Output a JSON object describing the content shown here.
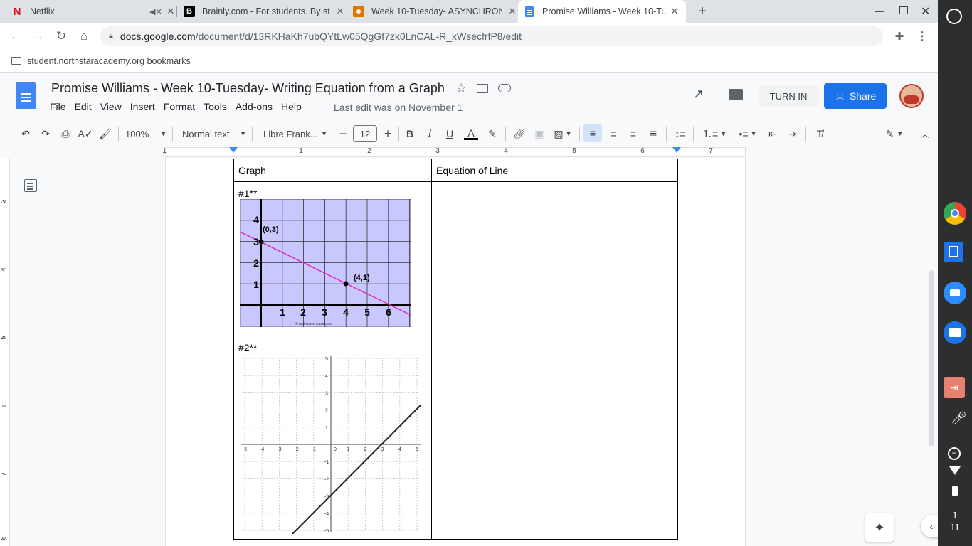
{
  "tabs": [
    {
      "title": "Netflix",
      "favicon": "N"
    },
    {
      "title": "Brainly.com - For students. By st",
      "favicon": "B"
    },
    {
      "title": "Week 10-Tuesday- ASYNCHRON",
      "favicon": "classroom-icon"
    },
    {
      "title": "Promise Williams - Week 10-Tue",
      "favicon": "docs-icon",
      "active": true
    }
  ],
  "url": {
    "domain": "docs.google.com",
    "path": "/document/d/13RKHaKh7ubQYtLw05QgGf7zk0LnCAL-R_xWsecfrfP8/edit"
  },
  "bookmarks": {
    "label": "student.northstaracademy.org bookmarks"
  },
  "doc": {
    "title": "Promise Williams - Week 10-Tuesday- Writing Equation from a Graph",
    "menus": [
      "File",
      "Edit",
      "View",
      "Insert",
      "Format",
      "Tools",
      "Add-ons",
      "Help"
    ],
    "last_edit": "Last edit was on November 1",
    "turn_in": "TURN IN",
    "share": "Share"
  },
  "format": {
    "zoom": "100%",
    "style": "Normal text",
    "font": "Libre Frank...",
    "size": "12"
  },
  "ruler": {
    "h": [
      "1",
      "1",
      "2",
      "3",
      "4",
      "5",
      "6",
      "7"
    ],
    "v": [
      "3",
      "4",
      "5",
      "6",
      "7",
      "8"
    ]
  },
  "table": {
    "headers": [
      "Graph",
      "Equation of Line"
    ],
    "rows": [
      {
        "label": "#1**"
      },
      {
        "label": "#2**"
      }
    ]
  },
  "graph1": {
    "y_ticks": [
      "4",
      "3",
      "2",
      "1"
    ],
    "x_ticks": [
      "1",
      "2",
      "3",
      "4",
      "5",
      "6"
    ],
    "points": [
      {
        "label": "(0,3)"
      },
      {
        "label": "(4,1)"
      }
    ],
    "line_color": "#e020c0",
    "bg": "#c8c8ff",
    "watermark": "© mathwarehouse.com"
  },
  "graph2": {
    "x_ticks": [
      "-5",
      "-4",
      "-3",
      "-2",
      "-1",
      "0",
      "1",
      "2",
      "3",
      "4",
      "5"
    ],
    "y_ticks": [
      "5",
      "4",
      "3",
      "2",
      "1",
      "0",
      "-1",
      "-2",
      "-3",
      "-4",
      "-5"
    ]
  },
  "shelf": {
    "time_hour": "1",
    "time_min": "11"
  }
}
